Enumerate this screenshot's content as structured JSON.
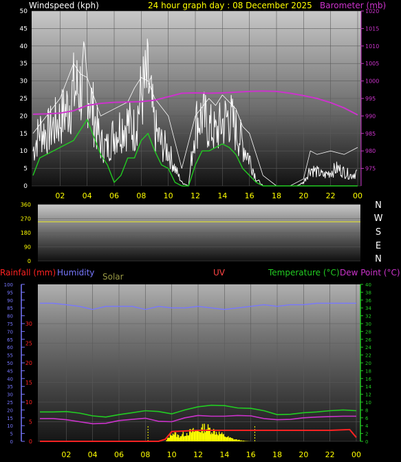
{
  "header": {
    "wind_title": "Windspeed (kph)",
    "graph_title": "24 hour graph day : 08 December 2025",
    "baro_title": "Barometer (mb)"
  },
  "lower_header": {
    "rainfall": "Rainfall (mm)",
    "humidity": "Humidity",
    "solar": "Solar",
    "uv": "UV",
    "temperature": "Temperature (°C)",
    "dewpoint": "Dew Point (°C)"
  },
  "colors": {
    "wind": "#ffffff",
    "wind_avg": "#22cc22",
    "barometer": "#cc33cc",
    "direction": "#cccc44",
    "rain": "#ff2222",
    "humidity": "#7777ff",
    "solar": "#ffff00",
    "temperature": "#22cc22",
    "dewpoint": "#cc33cc",
    "uv_label": "#ff4444",
    "header": "#ffff00"
  },
  "chart_data": [
    {
      "type": "line",
      "name": "wind-barometer",
      "x_ticks": [
        "02",
        "04",
        "06",
        "08",
        "10",
        "12",
        "14",
        "16",
        "18",
        "20",
        "22",
        "00"
      ],
      "y_left": {
        "label": "Windspeed (kph)",
        "ylim": [
          0,
          50
        ],
        "ticks": [
          0,
          5,
          10,
          15,
          20,
          25,
          30,
          35,
          40,
          45,
          50
        ]
      },
      "y_right": {
        "label": "Barometer (mb)",
        "ylim": [
          970,
          1020
        ],
        "ticks": [
          975,
          980,
          985,
          990,
          995,
          1000,
          1005,
          1010,
          1015,
          1020
        ]
      },
      "series": [
        {
          "name": "Windspeed (kph)",
          "axis": "left",
          "x": [
            0,
            0.5,
            1,
            1.5,
            2,
            2.5,
            3,
            3.5,
            4,
            4.5,
            5,
            5.5,
            6,
            6.5,
            7,
            7.5,
            8,
            8.5,
            9,
            9.5,
            10,
            10.5,
            11,
            11.5,
            12,
            12.5,
            13,
            13.5,
            14,
            14.5,
            15,
            15.5,
            16,
            16.5,
            17,
            17.5,
            18,
            18.5,
            19,
            19.5,
            20,
            20.5,
            21,
            21.5,
            22,
            22.5,
            23,
            23.5,
            24
          ],
          "values": [
            10,
            16,
            15,
            17,
            19,
            22,
            27,
            28,
            30,
            20,
            12,
            11,
            15,
            17,
            18,
            16,
            26,
            30,
            16,
            12,
            10,
            5,
            1,
            0,
            18,
            20,
            17,
            15,
            18,
            20,
            16,
            12,
            8,
            2,
            0,
            0,
            0,
            0,
            0,
            0,
            1,
            5,
            4,
            3,
            4,
            5,
            4,
            3,
            4
          ]
        },
        {
          "name": "Gust (kph)",
          "axis": "left",
          "x": [
            0,
            1,
            2,
            3,
            3.5,
            4,
            5,
            6,
            7,
            7.5,
            8,
            8.5,
            9,
            10,
            11,
            12,
            13,
            13.5,
            14,
            15,
            15.5,
            16,
            17,
            18,
            19,
            20,
            20.5,
            21,
            22,
            23,
            24
          ],
          "values": [
            15,
            20,
            25,
            35,
            32,
            31,
            20,
            22,
            24,
            28,
            31,
            30,
            25,
            20,
            5,
            20,
            25,
            23,
            26,
            22,
            17,
            15,
            3,
            0,
            0,
            2,
            10,
            9,
            10,
            9,
            11
          ]
        },
        {
          "name": "Average wind (kph)",
          "axis": "left",
          "x": [
            0,
            0.5,
            1,
            1.5,
            2,
            2.5,
            3,
            3.5,
            4,
            4.5,
            5,
            5.5,
            6,
            6.5,
            7,
            7.5,
            8,
            8.5,
            9,
            9.5,
            10,
            10.5,
            11,
            11.5,
            12,
            12.5,
            13,
            13.5,
            14,
            14.5,
            15,
            15.5,
            16,
            16.5,
            17,
            18,
            19,
            20,
            21,
            22,
            23,
            24
          ],
          "values": [
            3,
            8,
            9,
            10,
            11,
            12,
            13,
            16,
            19,
            14,
            9,
            6,
            1,
            3,
            8,
            8,
            13,
            15,
            10,
            6,
            5,
            1,
            0,
            0,
            6,
            10,
            10,
            11,
            12,
            11,
            9,
            5,
            3,
            1,
            0,
            0,
            0,
            0,
            0,
            0,
            0,
            0
          ]
        },
        {
          "name": "Barometer (mb)",
          "axis": "right",
          "x": [
            0,
            1,
            2,
            3,
            4,
            5,
            6,
            7,
            8,
            9,
            10,
            11,
            12,
            13,
            14,
            15,
            16,
            17,
            18,
            19,
            20,
            21,
            22,
            23,
            24
          ],
          "values": [
            990.5,
            990.6,
            990.8,
            991.5,
            993.0,
            993.6,
            993.9,
            994.0,
            994.1,
            994.5,
            995.5,
            996.5,
            996.6,
            996.5,
            996.6,
            996.8,
            997.0,
            997.1,
            997.0,
            996.5,
            995.8,
            995.0,
            993.8,
            992.3,
            990.3
          ]
        }
      ]
    },
    {
      "type": "line",
      "name": "wind-direction",
      "y_left": {
        "ylim": [
          0,
          360
        ],
        "ticks": [
          0,
          90,
          180,
          270,
          360
        ]
      },
      "y_right_labels": [
        "N",
        "W",
        "S",
        "E",
        "N"
      ],
      "series": [
        {
          "name": "Wind direction",
          "x": [
            0,
            24
          ],
          "values": [
            250,
            250
          ]
        }
      ]
    },
    {
      "type": "line",
      "name": "temperature-humidity-rain",
      "x_ticks": [
        "02",
        "04",
        "06",
        "08",
        "10",
        "12",
        "14",
        "16",
        "18",
        "20",
        "22",
        "00"
      ],
      "axes": {
        "humidity": {
          "ylim": [
            0,
            100
          ],
          "ticks": [
            0,
            5,
            10,
            15,
            20,
            25,
            30,
            35,
            40,
            45,
            50,
            55,
            60,
            65,
            70,
            75,
            80,
            85,
            90,
            95,
            100
          ]
        },
        "rainfall": {
          "ylim": [
            0,
            40
          ],
          "ticks": [
            0,
            5,
            10,
            15,
            20,
            25,
            30
          ]
        },
        "temperature": {
          "ylim": [
            0,
            40
          ],
          "ticks": [
            0,
            2,
            4,
            6,
            8,
            10,
            12,
            14,
            16,
            18,
            20,
            22,
            24,
            26,
            28,
            30,
            32,
            34,
            36,
            38,
            40
          ]
        }
      },
      "series": [
        {
          "name": "Humidity",
          "axis": "humidity",
          "x": [
            0,
            1,
            2,
            3,
            4,
            5,
            6,
            7,
            8,
            9,
            10,
            11,
            12,
            13,
            14,
            15,
            16,
            17,
            18,
            19,
            20,
            21,
            22,
            23,
            24
          ],
          "values": [
            88,
            88,
            87,
            86,
            84,
            86,
            86,
            86,
            84,
            86,
            85,
            85,
            86,
            85,
            84,
            85,
            86,
            87,
            86,
            87,
            87,
            88,
            88,
            88,
            88
          ]
        },
        {
          "name": "Temperature (°C)",
          "axis": "temperature",
          "x": [
            0,
            1,
            2,
            3,
            4,
            5,
            6,
            7,
            8,
            9,
            10,
            11,
            12,
            13,
            14,
            15,
            16,
            17,
            18,
            19,
            20,
            21,
            22,
            23,
            24
          ],
          "values": [
            7.5,
            7.5,
            7.6,
            7.2,
            6.5,
            6.2,
            6.8,
            7.3,
            7.8,
            7.6,
            7.0,
            8.0,
            8.8,
            9.2,
            9.1,
            8.5,
            8.4,
            7.8,
            6.8,
            6.9,
            7.3,
            7.5,
            7.8,
            8.0,
            7.8
          ]
        },
        {
          "name": "Dew Point (°C)",
          "axis": "temperature",
          "x": [
            0,
            1,
            2,
            3,
            4,
            5,
            6,
            7,
            8,
            9,
            10,
            11,
            12,
            13,
            14,
            15,
            16,
            17,
            18,
            19,
            20,
            21,
            22,
            23,
            24
          ],
          "values": [
            5.8,
            5.8,
            5.5,
            5.0,
            4.5,
            4.6,
            5.3,
            5.6,
            5.9,
            5.1,
            5.0,
            6.0,
            6.6,
            6.4,
            6.4,
            6.6,
            6.5,
            5.8,
            5.5,
            5.6,
            6.0,
            6.2,
            6.3,
            6.4,
            6.4
          ]
        },
        {
          "name": "Rainfall (mm)",
          "axis": "rainfall",
          "x": [
            0,
            9,
            9.5,
            10,
            12,
            14,
            16,
            18,
            20,
            22,
            23.5,
            24
          ],
          "values": [
            0,
            0,
            0.5,
            2.5,
            2.8,
            2.8,
            2.8,
            2.8,
            2.8,
            2.8,
            3.0,
            1.0
          ]
        },
        {
          "name": "Solar",
          "axis": "temperature",
          "x": [
            9.5,
            10,
            10.5,
            11,
            11.5,
            12,
            12.5,
            13,
            13.5,
            14,
            14.5,
            15,
            15.5,
            16
          ],
          "values": [
            0,
            2.5,
            1.5,
            2.2,
            2.8,
            3.0,
            4.0,
            3.2,
            2.4,
            1.5,
            0.8,
            0.4,
            0.1,
            0
          ]
        }
      ],
      "markers": {
        "sunrise_hour": 8.2,
        "sunset_hour": 16.3
      }
    }
  ]
}
